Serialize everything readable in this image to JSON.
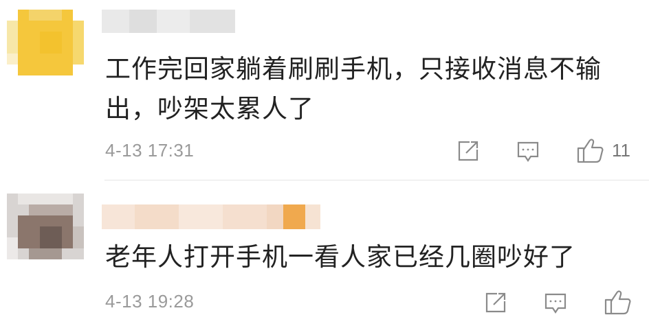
{
  "comments": [
    {
      "text": "工作完回家躺着刷刷手机，只接收消息不输出，吵架太累人了",
      "time": "4-13 17:31",
      "likes": "11",
      "avatar_color": "#f5c842"
    },
    {
      "text": "老年人打开手机一看人家已经几圈吵好了",
      "time": "4-13 19:28",
      "likes": "",
      "avatar_color": "#7d6a62"
    }
  ],
  "icons": {
    "share": "share-icon",
    "reply": "comment-icon",
    "like": "thumbs-up-icon"
  },
  "colors": {
    "text": "#222222",
    "meta": "#9a9a9a",
    "icon": "#8a8a8a"
  }
}
